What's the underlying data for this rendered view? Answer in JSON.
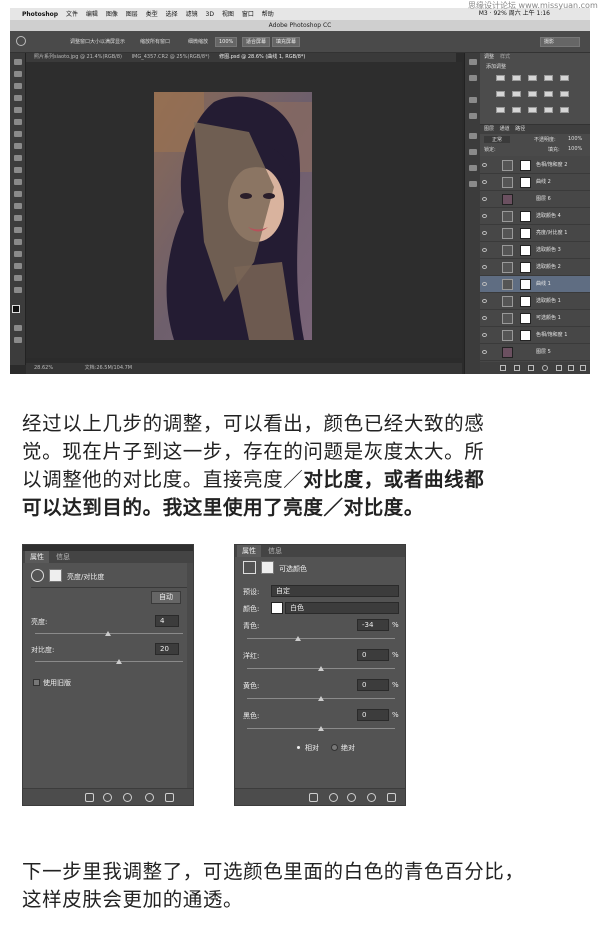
{
  "ps": {
    "menubar": {
      "apple": "",
      "app": "Photoshop",
      "items": [
        "文件",
        "编辑",
        "图像",
        "图层",
        "类型",
        "选择",
        "滤镜",
        "3D",
        "视图",
        "窗口",
        "帮助"
      ],
      "right": "M3 · 92% 周六 上午 1:16"
    },
    "title": "Adobe Photoshop CC",
    "options": {
      "check1": "调整窗口大小以满屏显示",
      "check2": "缩放所有窗口",
      "check3": "细微缩放",
      "zoom_btn": "100%",
      "fit_btn": "适合屏幕",
      "fill_btn": "填充屏幕",
      "workspace": "摄影"
    },
    "doc_tabs": [
      "照片系列siaoto.jpg @ 21.4%(RGB/8)",
      "IMG_4357.CR2 @ 25%(RGB/8*)",
      "修图.psd @ 28.6% (曲线 1, RGB/8*)"
    ],
    "status": {
      "zoom": "28.62%",
      "doc": "文档:26.5M/104.7M"
    },
    "adjust_panel": {
      "tab1": "调整",
      "tab2": "样式",
      "title": "添加调整"
    },
    "layers_panel": {
      "tabs": [
        "图层",
        "通道",
        "路径"
      ],
      "mode": "正常",
      "opacity_label": "不透明度:",
      "opacity": "100%",
      "fill_label": "填充:",
      "fill": "100%",
      "lock_label": "锁定:"
    },
    "layers": [
      {
        "name": "色相/饱和度 2",
        "kind": "adj"
      },
      {
        "name": "曲线 2",
        "kind": "adj"
      },
      {
        "name": "图层 6",
        "kind": "photo"
      },
      {
        "name": "选取颜色 4",
        "kind": "adj"
      },
      {
        "name": "亮度/对比度 1",
        "kind": "adj"
      },
      {
        "name": "选取颜色 3",
        "kind": "adj"
      },
      {
        "name": "选取颜色 2",
        "kind": "adj"
      },
      {
        "name": "曲线 1",
        "kind": "adj",
        "selected": true
      },
      {
        "name": "选取颜色 1",
        "kind": "adj"
      },
      {
        "name": "可选颜色 1",
        "kind": "adj"
      },
      {
        "name": "色相/饱和度 1",
        "kind": "adj"
      },
      {
        "name": "图层 5",
        "kind": "photo"
      }
    ]
  },
  "watermark": "思缘设计论坛 www.missyuan.com",
  "para1": [
    "经过以上几步的调整，可以看出，颜色已经大致的感",
    "觉。现在片子到这一步，存在的问题是灰度太大。所"
  ],
  "para1_line3_normal": "以调整他的对比度。直接亮度／",
  "para1_line3_bold": "对比度，或者曲线都",
  "para1_line4_bold": "可以达到目的。我这里使用了亮度／对比度。",
  "dialog1": {
    "top_text": "",
    "tab_props": "属性",
    "tab_info": "信息",
    "title": "亮度/对比度",
    "auto": "自动",
    "brightness_label": "亮度:",
    "brightness": "4",
    "contrast_label": "对比度:",
    "contrast": "20",
    "legacy": "使用旧版"
  },
  "dialog2": {
    "tab_props": "属性",
    "tab_info": "信息",
    "title": "可选颜色",
    "preset_label": "预设:",
    "preset": "自定",
    "color_label": "颜色:",
    "color": "白色",
    "cyan_label": "青色:",
    "cyan": "-34",
    "magenta_label": "洋红:",
    "magenta": "0",
    "yellow_label": "黄色:",
    "yellow": "0",
    "black_label": "黑色:",
    "black": "0",
    "pct": "%",
    "relative": "相对",
    "absolute": "绝对"
  },
  "para2": [
    "下一步里我调整了，可选颜色里面的白色的青色百分比，",
    "这样皮肤会更加的通透。"
  ]
}
